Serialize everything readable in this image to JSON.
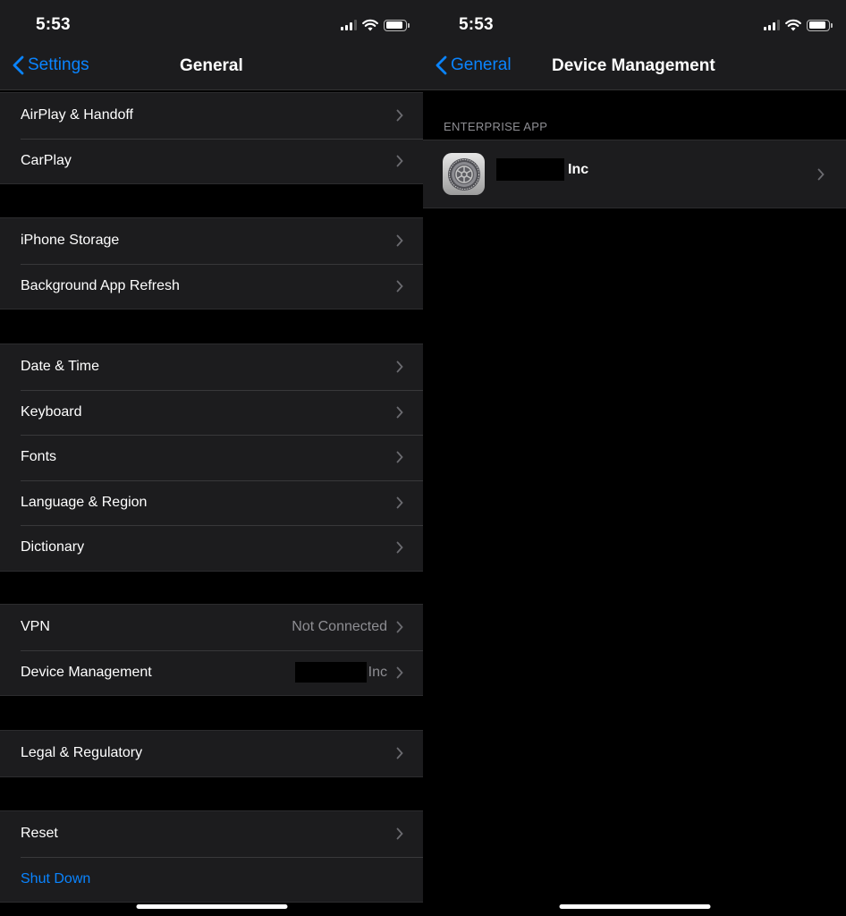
{
  "status_bar": {
    "time": "5:53"
  },
  "left": {
    "back_label": "Settings",
    "title": "General",
    "groups": [
      [
        {
          "label": "AirPlay & Handoff"
        },
        {
          "label": "CarPlay"
        }
      ],
      [
        {
          "label": "iPhone Storage"
        },
        {
          "label": "Background App Refresh"
        }
      ],
      [
        {
          "label": "Date & Time"
        },
        {
          "label": "Keyboard"
        },
        {
          "label": "Fonts"
        },
        {
          "label": "Language & Region"
        },
        {
          "label": "Dictionary"
        }
      ],
      [
        {
          "label": "VPN",
          "value": "Not Connected"
        },
        {
          "label": "Device Management",
          "value": "Inc"
        }
      ],
      [
        {
          "label": "Legal & Regulatory"
        }
      ],
      [
        {
          "label": "Reset"
        },
        {
          "label": "Shut Down"
        }
      ]
    ]
  },
  "right": {
    "back_label": "General",
    "title": "Device Management",
    "section_header": "ENTERPRISE APP",
    "app": {
      "name": "Inc",
      "icon": "gear-icon"
    }
  },
  "colors": {
    "accent": "#0a84ff",
    "background": "#000000",
    "cell": "#1c1c1e",
    "secondary_text": "#8e8e93"
  }
}
